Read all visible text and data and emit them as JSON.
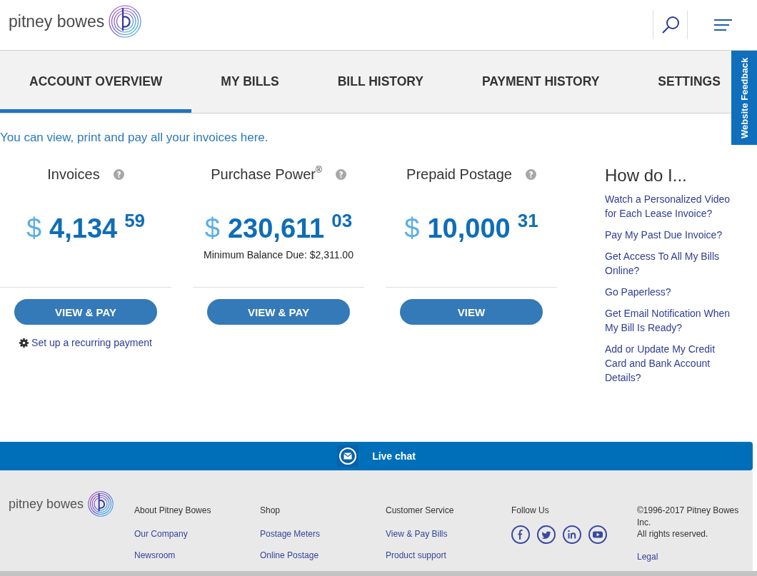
{
  "header": {
    "brand": "pitney bowes"
  },
  "tabs": [
    {
      "label": "ACCOUNT OVERVIEW",
      "selected": true
    },
    {
      "label": "MY BILLS",
      "selected": false
    },
    {
      "label": "BILL HISTORY",
      "selected": false
    },
    {
      "label": "PAYMENT HISTORY",
      "selected": false
    },
    {
      "label": "SETTINGS",
      "selected": false
    }
  ],
  "feedback_tab": {
    "label": "Website Feedback"
  },
  "intro": "You can view, print and pay all your invoices here.",
  "cards": [
    {
      "title": "Invoices",
      "amount": {
        "currency": "$",
        "whole": "4,134",
        "cents": "59"
      },
      "button": "VIEW & PAY",
      "link": "Set up a recurring payment"
    },
    {
      "title": "Purchase Power$^{®}$",
      "amount": {
        "currency": "$",
        "whole": "230,611",
        "cents": "03"
      },
      "note": "Minimum Balance Due: $2,311.00",
      "button": "VIEW & PAY"
    },
    {
      "title": "Prepaid Postage",
      "amount": {
        "currency": "$",
        "whole": "10,000",
        "cents": "31"
      },
      "button": "VIEW"
    }
  ],
  "how_do_i": {
    "title": "How do I...",
    "links": [
      "Watch a Personalized Video for Each Lease Invoice?",
      "Pay My Past Due Invoice?",
      "Get Access To All My Bills Online?",
      "Go Paperless?",
      "Get Email Notification When My Bill Is Ready?",
      "Add or Update My Credit Card and Bank Account Details?"
    ]
  },
  "live_chat": {
    "label": "Live chat"
  },
  "footer": {
    "brand": "pitney bowes",
    "columns": [
      {
        "heading": "About Pitney Bowes",
        "links": [
          "Our Company",
          "Newsroom"
        ]
      },
      {
        "heading": "Shop",
        "links": [
          "Postage Meters",
          "Online Postage"
        ]
      },
      {
        "heading": "Customer Service",
        "links": [
          "View & Pay Bills",
          "Product support"
        ]
      },
      {
        "heading": "Follow Us",
        "social": [
          {
            "kind": "facebook"
          },
          {
            "kind": "twitter"
          },
          {
            "kind": "linkedin"
          },
          {
            "kind": "youtube"
          }
        ]
      }
    ],
    "legal": {
      "copyright": "©1996-2017 Pitney Bowes Inc.",
      "rights": "All rights reserved.",
      "link": "Legal"
    }
  }
}
